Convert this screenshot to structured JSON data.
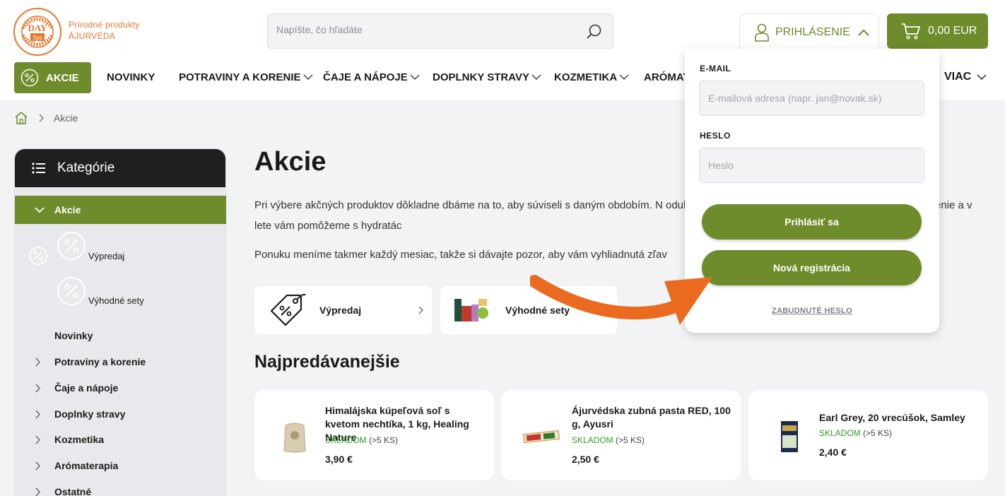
{
  "brand": {
    "logo_alt": "DAY Spa Ayurveda Aromatherapy",
    "tagline_line1": "Prírodné produkty",
    "tagline_line2": "ÁJURVÉDA"
  },
  "search": {
    "placeholder": "Napíšte, čo hľadáte"
  },
  "header": {
    "login_label": "PRIHLÁSENIE",
    "cart_label": "0,00 EUR"
  },
  "nav": {
    "items": [
      {
        "label": "AKCIE"
      },
      {
        "label": "NOVINKY"
      },
      {
        "label": "POTRAVINY A KORENIE"
      },
      {
        "label": "ČAJE A NÁPOJE"
      },
      {
        "label": "DOPLNKY STRAVY"
      },
      {
        "label": "KOZMETIKA"
      },
      {
        "label": "ARÓMAT"
      }
    ],
    "more_label": "VIAC"
  },
  "breadcrumb": {
    "current": "Akcie"
  },
  "sidebar": {
    "title": "Kategórie",
    "active": "Akcie",
    "sub_items": [
      "Výpredaj",
      "Výhodné sety"
    ],
    "items": [
      "Novinky",
      "Potraviny a korenie",
      "Čaje a nápoje",
      "Doplnky stravy",
      "Kozmetika",
      "Arómaterapia",
      "Ostatné"
    ]
  },
  "main": {
    "title": "Akcie",
    "para1": "Pri výbere akčných produktov dôkladne dbáme na to, aby súviseli s daným obdobím. N                                                                                 odukty na detox organizmu, v zime zase na vianočné pečenie a v lete vám pomôžeme s hydratác",
    "para2": "Ponuku meníme takmer každý mesiac, takže si dávajte pozor, aby vám vyhliadnutá zľav",
    "categories": [
      {
        "name": "Výpredaj"
      },
      {
        "name": "Výhodné sety"
      }
    ],
    "bestsellers_title": "Najpredávanejšie",
    "products": [
      {
        "title": "Himalájska kúpeľová soľ s kvetom nechtíka, 1 kg, Healing Nature",
        "stock": "SKLADOM",
        "stock_qty": "(>5 KS)",
        "price": "3,90 €"
      },
      {
        "title": "Ájurvédska zubná pasta RED, 100 g, Ayusri",
        "stock": "SKLADOM",
        "stock_qty": "(>5 KS)",
        "price": "2,50 €"
      },
      {
        "title": "Earl Grey, 20 vrecúšok, Samley",
        "stock": "SKLADOM",
        "stock_qty": "(>5 KS)",
        "price": "2,40 €"
      }
    ]
  },
  "login": {
    "email_label": "E-MAIL",
    "email_placeholder": "E-mailová adresa (napr. jan@novak.sk)",
    "password_label": "HESLO",
    "password_placeholder": "Heslo",
    "submit_label": "Prihlásiť sa",
    "register_label": "Nová registrácia",
    "forgot_label": "ZABUDNUTÉ HESLO"
  },
  "colors": {
    "brand_green": "#6e8c2b",
    "brand_orange": "#e8752a",
    "stock_green": "#2f9e1f",
    "arrow_orange": "#ea6b1f"
  }
}
